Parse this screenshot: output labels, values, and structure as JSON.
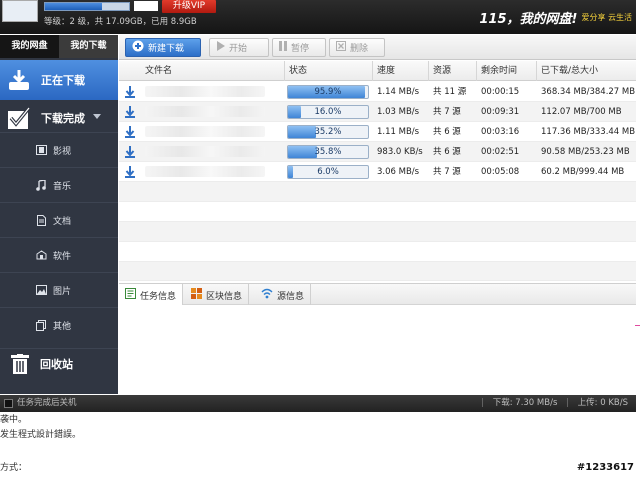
{
  "top": {
    "level_progress": 0.68,
    "vip_label": "升级VIP",
    "quota_text": "等级：2 级，共 17.09GB，已用 8.9GB",
    "brand_logo": "115，我的网盘!",
    "brand_slogan": "爱分享 云生活"
  },
  "left_tabs": [
    {
      "label": "我的网盘"
    },
    {
      "label": "我的下载"
    }
  ],
  "sidebar": {
    "downloading": "正在下载",
    "done": "下载完成",
    "items": [
      {
        "label": "影视",
        "icon": "film-icon"
      },
      {
        "label": "音乐",
        "icon": "music-icon"
      },
      {
        "label": "文档",
        "icon": "document-icon"
      },
      {
        "label": "软件",
        "icon": "software-icon"
      },
      {
        "label": "图片",
        "icon": "picture-icon"
      },
      {
        "label": "其他",
        "icon": "other-icon"
      }
    ],
    "trash": "回收站"
  },
  "toolbar": {
    "new_label": "新建下载",
    "start_label": "开始",
    "pause_label": "暂停",
    "delete_label": "删除"
  },
  "table": {
    "headers": [
      "文件名",
      "状态",
      "速度",
      "资源",
      "剩余时间",
      "已下载/总大小"
    ],
    "rows": [
      {
        "progress": 95.9,
        "progress_text": "95.9%",
        "speed": "1.14 MB/s",
        "sources": "共 11 源",
        "remaining": "00:00:15",
        "size": "368.34 MB/384.27 MB"
      },
      {
        "progress": 16.0,
        "progress_text": "16.0%",
        "speed": "1.03 MB/s",
        "sources": "共 7 源",
        "remaining": "00:09:31",
        "size": "112.07 MB/700 MB"
      },
      {
        "progress": 35.2,
        "progress_text": "35.2%",
        "speed": "1.11 MB/s",
        "sources": "共 6 源",
        "remaining": "00:03:16",
        "size": "117.36 MB/333.44 MB"
      },
      {
        "progress": 35.8,
        "progress_text": "35.8%",
        "speed": "983.0 KB/s",
        "sources": "共 6 源",
        "remaining": "00:02:51",
        "size": "90.58 MB/253.23 MB"
      },
      {
        "progress": 6.0,
        "progress_text": "6.0%",
        "speed": "3.06 MB/s",
        "sources": "共 7 源",
        "remaining": "00:05:08",
        "size": "60.2 MB/999.44 MB"
      }
    ]
  },
  "detail_tabs": [
    {
      "label": "任务信息"
    },
    {
      "label": "区块信息"
    },
    {
      "label": "源信息"
    }
  ],
  "statusbar": {
    "shutdown_label": "任务完成后关机",
    "download_speed": "下载: 7.30 MB/s",
    "upload_speed": "上传: 0 KB/S"
  },
  "background": {
    "line1": "袭中。",
    "line2": "发生程式設計錯誤。",
    "line3": "方式：",
    "tag": "#1233617"
  },
  "colors": {
    "accent_blue": "#2b68c2",
    "vip_red": "#c7261a",
    "sidebar_bg": "#303642",
    "brand_yellow": "#f5d13b"
  }
}
